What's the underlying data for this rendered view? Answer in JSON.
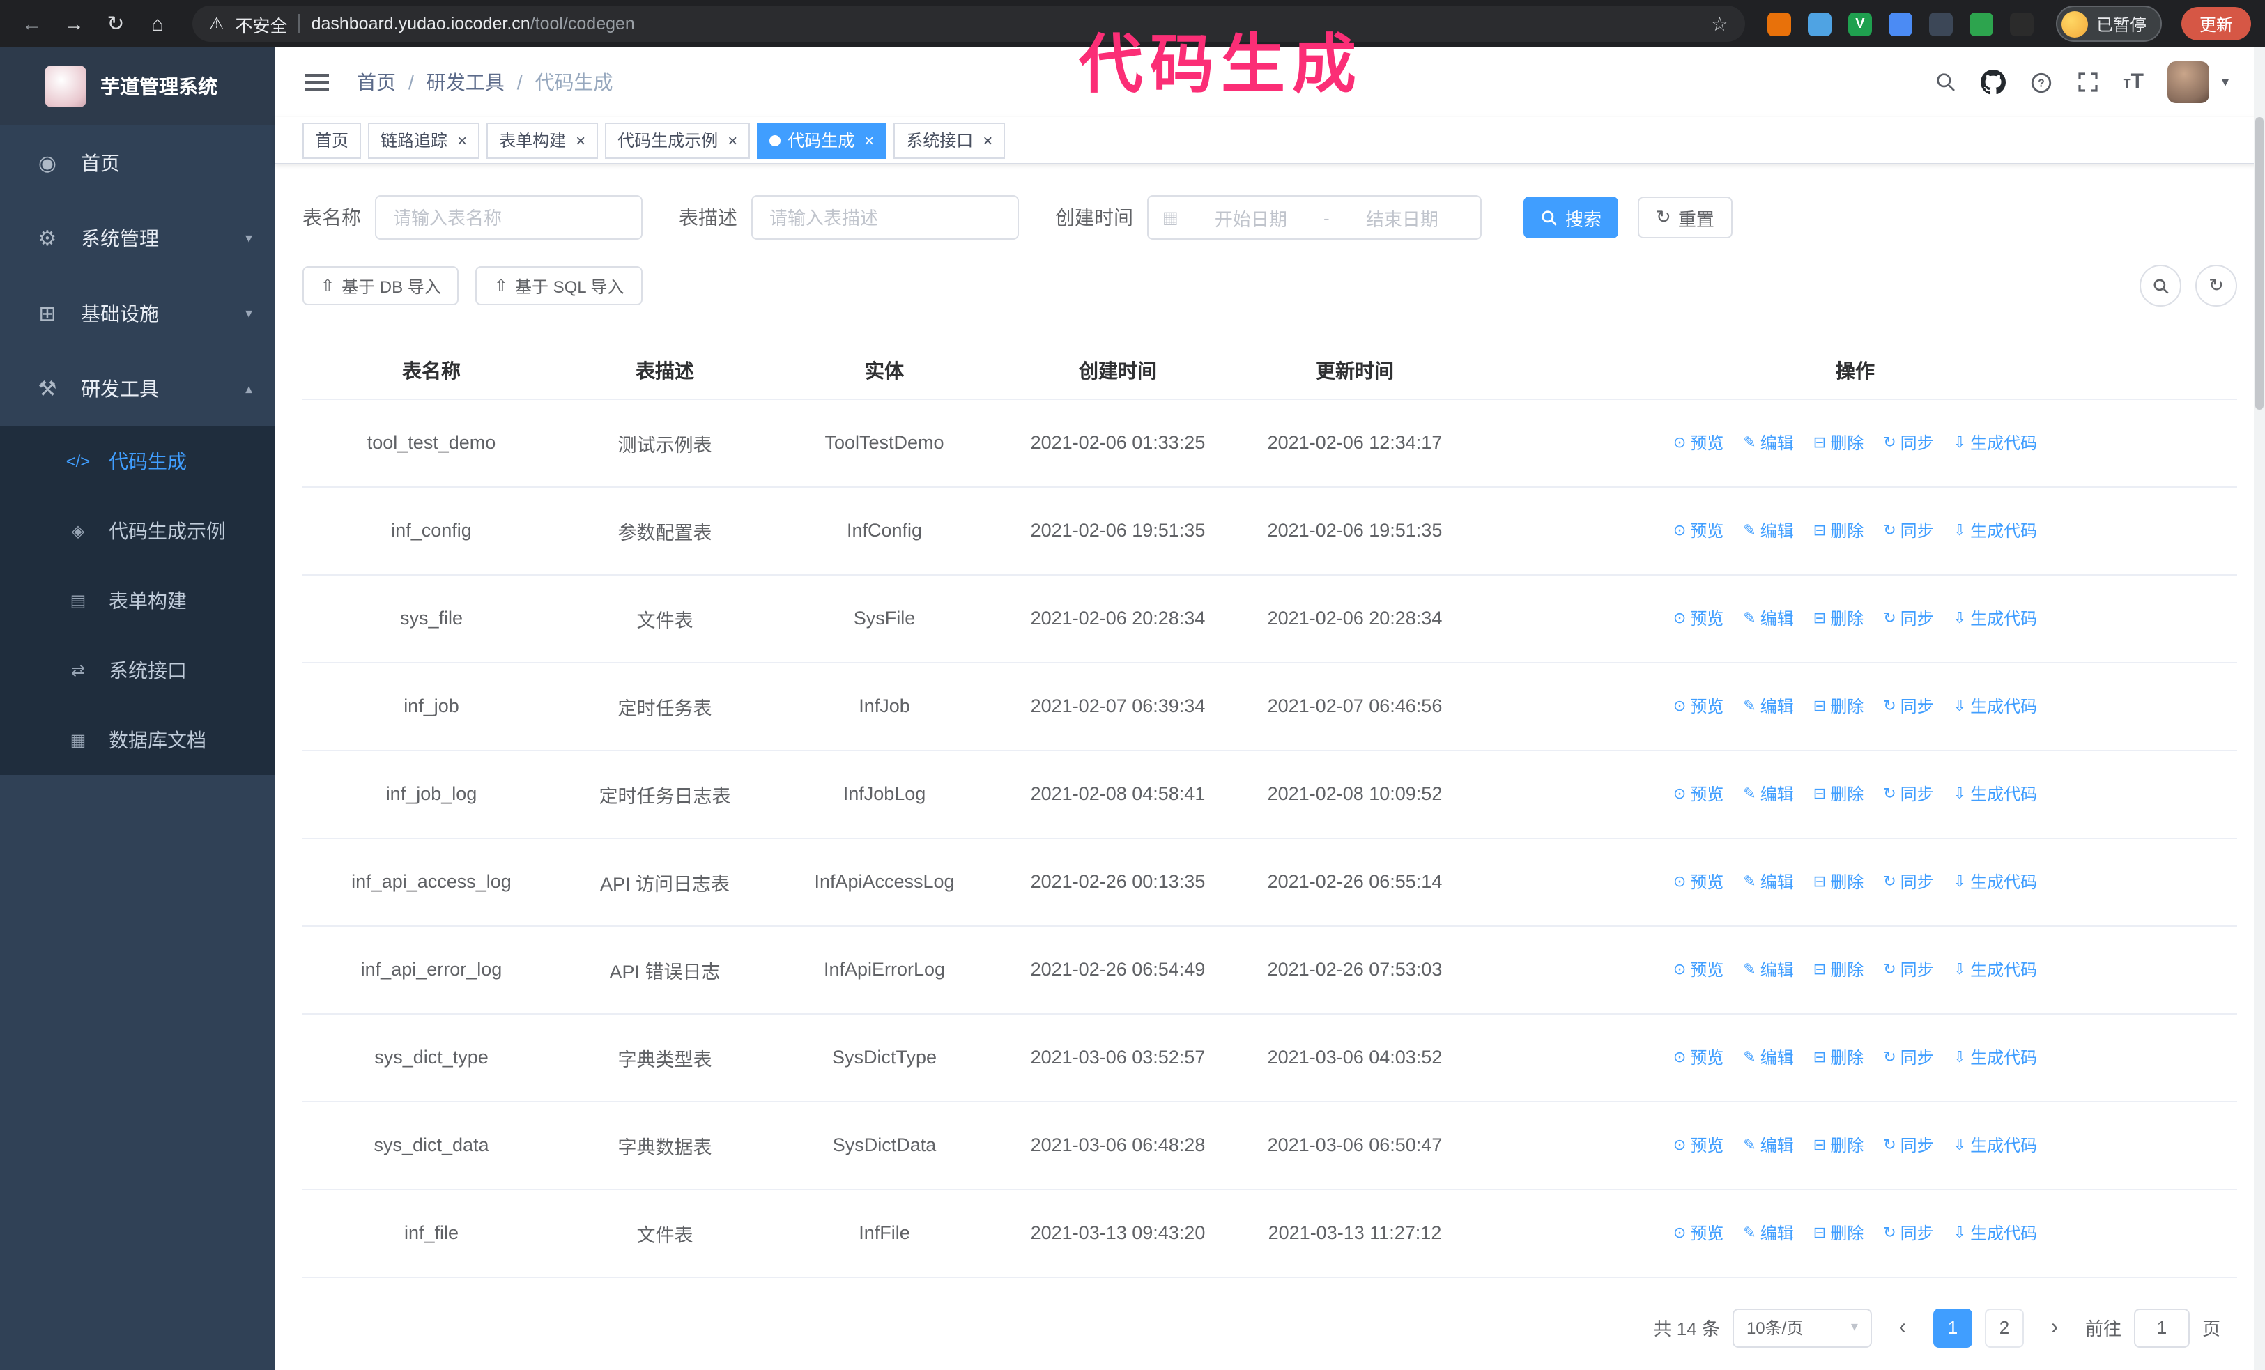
{
  "annotation": "代码生成",
  "browser": {
    "security_label": "不安全",
    "url_host": "dashboard.yudao.iocoder.cn",
    "url_path": "/tool/codegen",
    "profile_chip": "已暂停",
    "update_button": "更新",
    "extensions": [
      {
        "name": "extension-orange-icon",
        "color": "#e8710a",
        "glyph": ""
      },
      {
        "name": "extension-blue-drop-icon",
        "color": "#4fa3e3",
        "glyph": ""
      },
      {
        "name": "extension-green-v-icon",
        "color": "#1fa04f",
        "glyph": "V"
      },
      {
        "name": "extension-people-icon",
        "color": "#4b8bf4",
        "glyph": ""
      },
      {
        "name": "extension-proxy-icon",
        "color": "#3c4757",
        "glyph": ""
      },
      {
        "name": "extension-leaf-icon",
        "color": "#2da44e",
        "glyph": ""
      },
      {
        "name": "extension-monkey-icon",
        "color": "#2b2b2b",
        "glyph": ""
      }
    ]
  },
  "sidebar": {
    "title": "芋道管理系统",
    "menu": [
      {
        "label": "首页",
        "icon": "dashboard-icon",
        "glyph": "◉",
        "leaf": true
      },
      {
        "label": "系统管理",
        "icon": "system-gear-icon",
        "glyph": "⚙"
      },
      {
        "label": "基础设施",
        "icon": "infrastructure-icon",
        "glyph": "⊞"
      },
      {
        "label": "研发工具",
        "icon": "dev-tools-icon",
        "glyph": "⚒",
        "expanded": true
      }
    ],
    "submenu": [
      {
        "label": "代码生成",
        "icon": "codegen-icon",
        "glyph": "</>",
        "active": true
      },
      {
        "label": "代码生成示例",
        "icon": "codegen-example-icon",
        "glyph": "◈"
      },
      {
        "label": "表单构建",
        "icon": "form-builder-icon",
        "glyph": "▤"
      },
      {
        "label": "系统接口",
        "icon": "api-icon",
        "glyph": "⇄"
      },
      {
        "label": "数据库文档",
        "icon": "db-doc-icon",
        "glyph": "▦"
      }
    ]
  },
  "breadcrumb": {
    "items": [
      "首页",
      "研发工具",
      "代码生成"
    ],
    "separator": "/"
  },
  "tabs": [
    {
      "label": "首页",
      "affix": true
    },
    {
      "label": "链路追踪"
    },
    {
      "label": "表单构建"
    },
    {
      "label": "代码生成示例"
    },
    {
      "label": "代码生成",
      "active": true
    },
    {
      "label": "系统接口"
    }
  ],
  "filters": {
    "name_label": "表名称",
    "name_placeholder": "请输入表名称",
    "desc_label": "表描述",
    "desc_placeholder": "请输入表描述",
    "time_label": "创建时间",
    "date_start": "开始日期",
    "date_separator": "-",
    "date_end": "结束日期",
    "search_button": "搜索",
    "reset_button": "重置"
  },
  "toolbar": {
    "import_db": "基于 DB 导入",
    "import_sql": "基于 SQL 导入"
  },
  "table": {
    "columns": [
      "表名称",
      "表描述",
      "实体",
      "创建时间",
      "更新时间",
      "操作"
    ],
    "actions": [
      "预览",
      "编辑",
      "删除",
      "同步",
      "生成代码"
    ],
    "rows": [
      {
        "name": "tool_test_demo",
        "desc": "测试示例表",
        "entity": "ToolTestDemo",
        "created": "2021-02-06 01:33:25",
        "updated": "2021-02-06 12:34:17"
      },
      {
        "name": "inf_config",
        "desc": "参数配置表",
        "entity": "InfConfig",
        "created": "2021-02-06 19:51:35",
        "updated": "2021-02-06 19:51:35"
      },
      {
        "name": "sys_file",
        "desc": "文件表",
        "entity": "SysFile",
        "created": "2021-02-06 20:28:34",
        "updated": "2021-02-06 20:28:34"
      },
      {
        "name": "inf_job",
        "desc": "定时任务表",
        "entity": "InfJob",
        "created": "2021-02-07 06:39:34",
        "updated": "2021-02-07 06:46:56"
      },
      {
        "name": "inf_job_log",
        "desc": "定时任务日志表",
        "entity": "InfJobLog",
        "created": "2021-02-08 04:58:41",
        "updated": "2021-02-08 10:09:52"
      },
      {
        "name": "inf_api_access_log",
        "desc": "API 访问日志表",
        "entity": "InfApiAccessLog",
        "created": "2021-02-26 00:13:35",
        "updated": "2021-02-26 06:55:14"
      },
      {
        "name": "inf_api_error_log",
        "desc": "API 错误日志",
        "entity": "InfApiErrorLog",
        "created": "2021-02-26 06:54:49",
        "updated": "2021-02-26 07:53:03"
      },
      {
        "name": "sys_dict_type",
        "desc": "字典类型表",
        "entity": "SysDictType",
        "created": "2021-03-06 03:52:57",
        "updated": "2021-03-06 04:03:52"
      },
      {
        "name": "sys_dict_data",
        "desc": "字典数据表",
        "entity": "SysDictData",
        "created": "2021-03-06 06:48:28",
        "updated": "2021-03-06 06:50:47"
      },
      {
        "name": "inf_file",
        "desc": "文件表",
        "entity": "InfFile",
        "created": "2021-03-13 09:43:20",
        "updated": "2021-03-13 11:27:12"
      }
    ]
  },
  "pagination": {
    "total": "共 14 条",
    "page_size": "10条/页",
    "pages": [
      {
        "label": "1",
        "active": true
      },
      {
        "label": "2"
      }
    ],
    "goto_label": "前往",
    "goto_value": "1",
    "goto_suffix": "页"
  },
  "colors": {
    "primary": "#409eff",
    "annotation_pink": "#fb2e76",
    "sidebar_bg": "#304156",
    "submenu_bg": "#1f2d3d",
    "chrome_bg": "#202124"
  }
}
